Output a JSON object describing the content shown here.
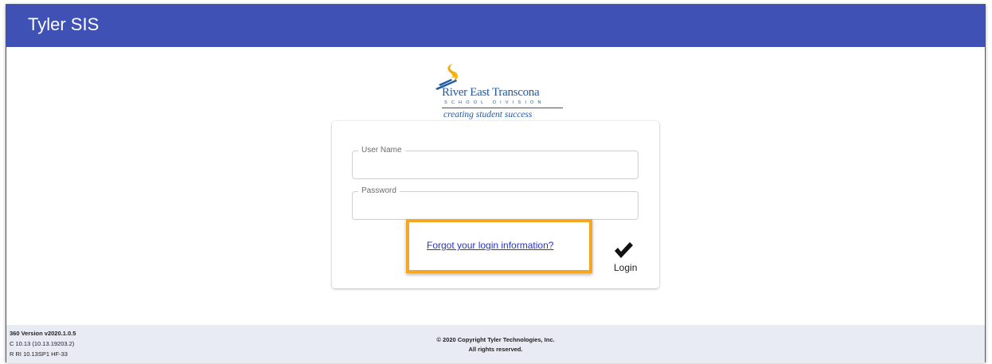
{
  "app": {
    "title": "Tyler SIS"
  },
  "logo": {
    "name": "River East Transcona",
    "division": "SCHOOL DIVISION",
    "tagline": "creating student success"
  },
  "login_form": {
    "username_label": "User Name",
    "username_value": "",
    "password_label": "Password",
    "password_value": "",
    "forgot_link": "Forgot your login information?",
    "login_label": "Login"
  },
  "footer": {
    "version_line1": "360 Version v2020.1.0.5",
    "version_line2": "C 10.13 (10.13.19203.2)",
    "version_line3": "R RI 10.13SP1 HF-33",
    "copyright": "© 2020 Copyright Tyler Technologies, Inc.",
    "rights": "All rights reserved."
  },
  "colors": {
    "app_bar": "#3f51b5",
    "highlight": "#f5a623",
    "link": "#2a33c4",
    "footer_bg": "#e8eaf4",
    "logo": "#1f5aa3"
  },
  "icons": {
    "login": "check-icon",
    "logo_mark": "flame-icon"
  }
}
